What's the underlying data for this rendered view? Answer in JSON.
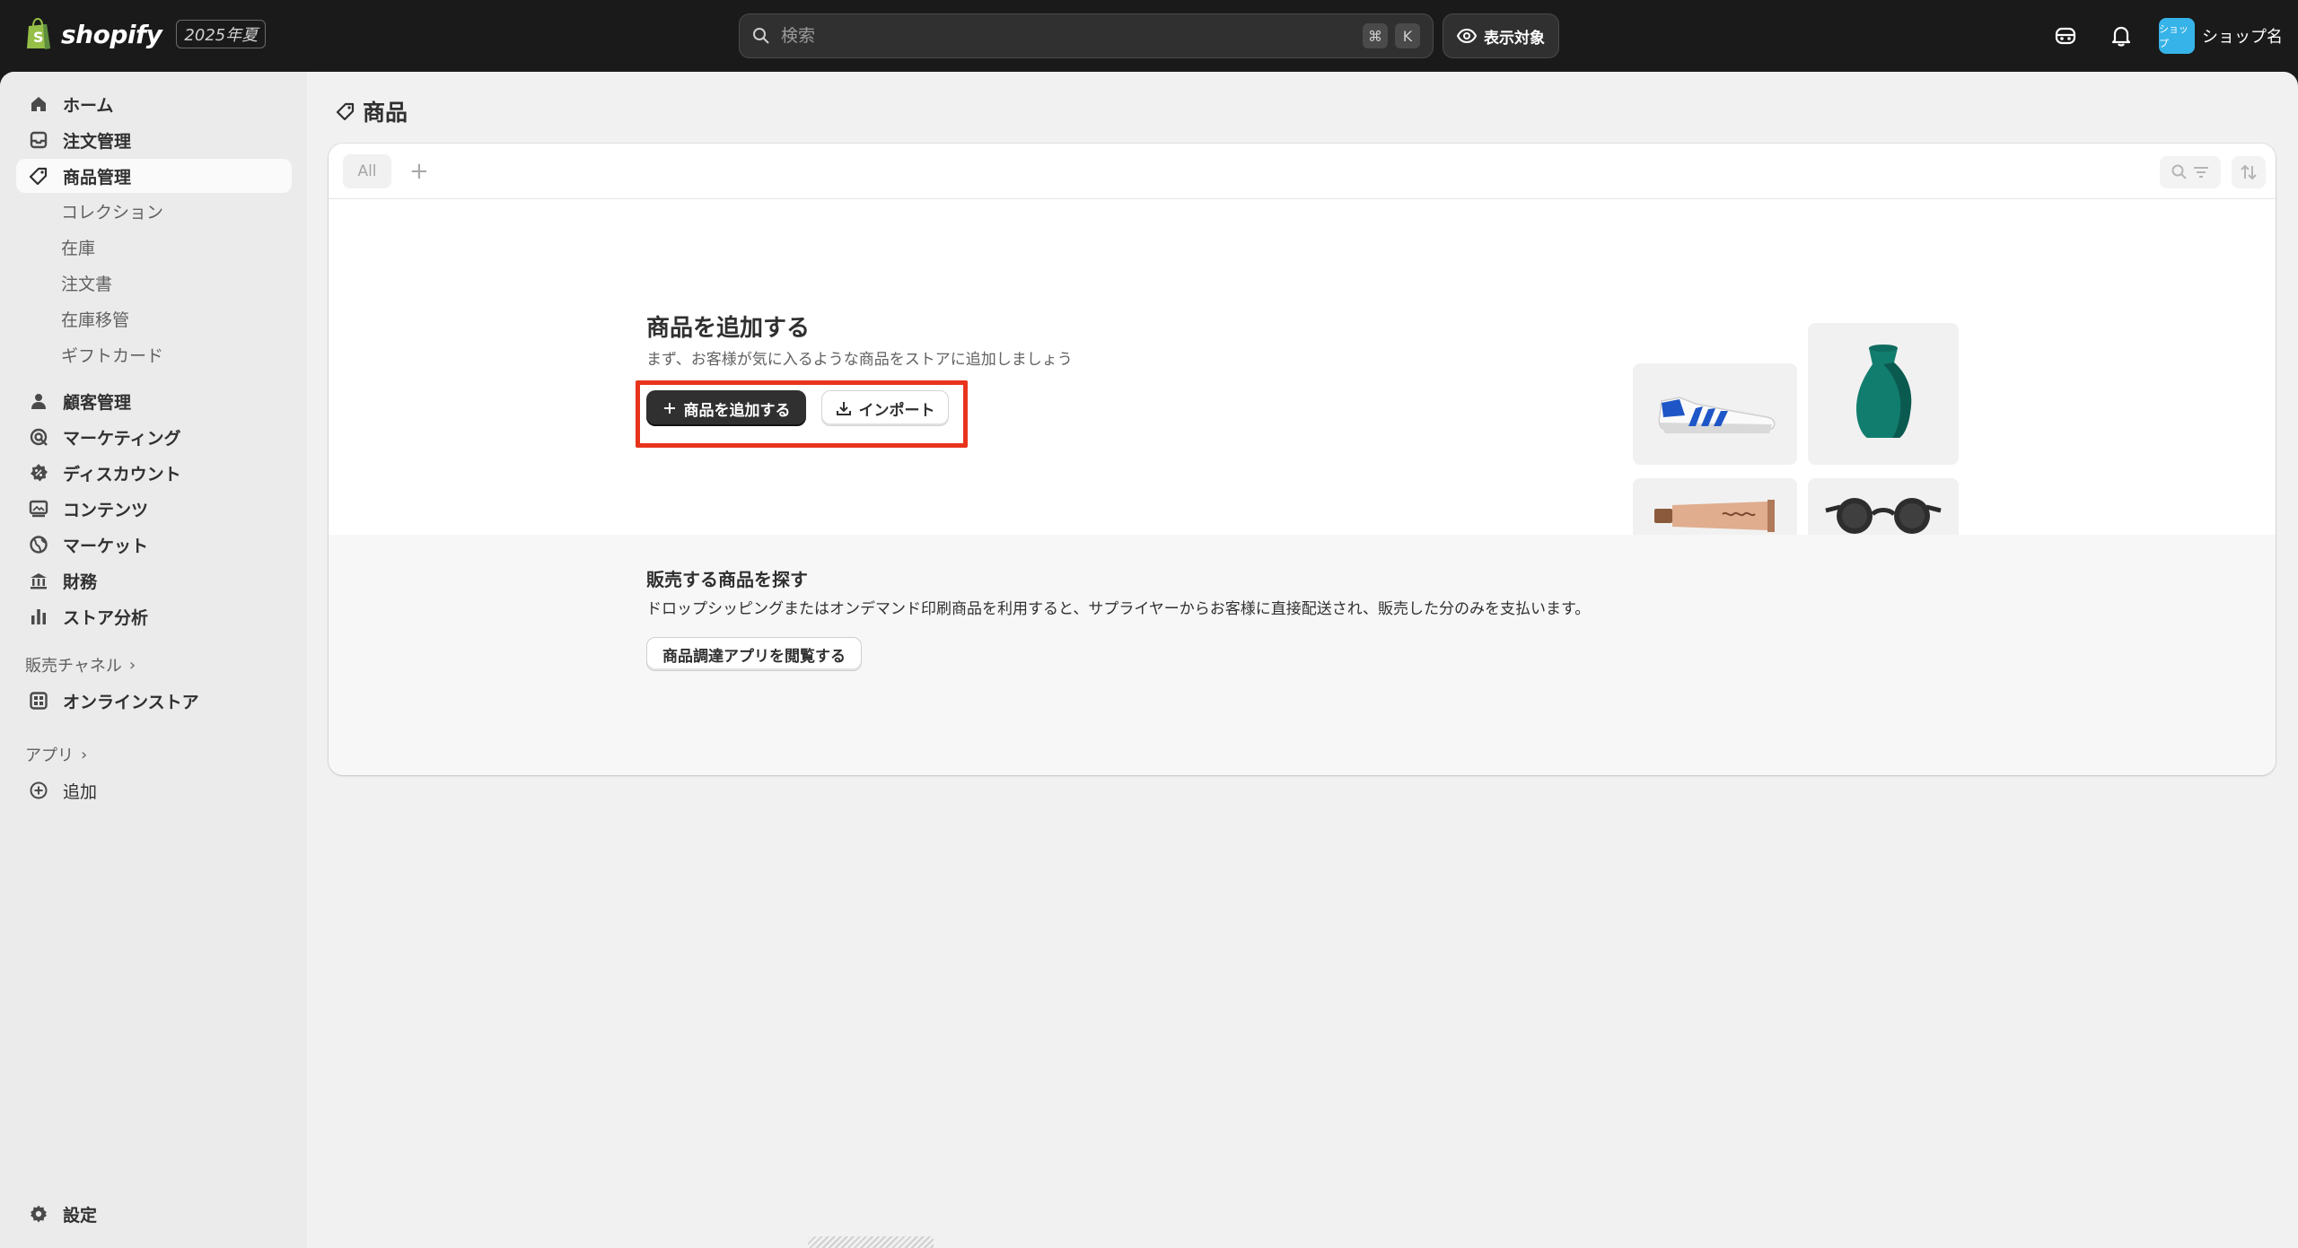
{
  "topbar": {
    "logo_text": "shopify",
    "edition": "2025年夏",
    "search_placeholder": "検索",
    "kbd_cmd": "⌘",
    "kbd_k": "K",
    "view_label": "表示対象",
    "shop_avatar": "ショップ",
    "shop_name": "ショップ名"
  },
  "sidebar": {
    "items": [
      {
        "label": "ホーム",
        "icon": "home-icon"
      },
      {
        "label": "注文管理",
        "icon": "inbox-icon"
      },
      {
        "label": "商品管理",
        "icon": "tag-icon"
      },
      {
        "label": "顧客管理",
        "icon": "person-icon"
      },
      {
        "label": "マーケティング",
        "icon": "target-icon"
      },
      {
        "label": "ディスカウント",
        "icon": "discount-icon"
      },
      {
        "label": "コンテンツ",
        "icon": "content-icon"
      },
      {
        "label": "マーケット",
        "icon": "globe-icon"
      },
      {
        "label": "財務",
        "icon": "bank-icon"
      },
      {
        "label": "ストア分析",
        "icon": "chart-icon"
      }
    ],
    "sub_items": [
      "コレクション",
      "在庫",
      "注文書",
      "在庫移管",
      "ギフトカード"
    ],
    "sales_channels_label": "販売チャネル",
    "online_store": "オンラインストア",
    "apps_label": "アプリ",
    "add_label": "追加",
    "settings_label": "設定"
  },
  "main": {
    "page_title": "商品",
    "tab_all": "All",
    "tab_add": "+",
    "empty_title": "商品を追加する",
    "empty_subtitle": "まず、お客様が気に入るような商品をストアに追加しましょう",
    "add_product_label": "商品を追加する",
    "import_label": "インポート",
    "discover_title": "販売する商品を探す",
    "discover_desc": "ドロップシッピングまたはオンデマンド印刷商品を利用すると、サプライヤーからお客様に直接配送され、販売した分のみを支払います。",
    "browse_label": "商品調達アプリを閲覧する"
  },
  "colors": {
    "highlight": "#e8341c",
    "primary_button": "#303030",
    "avatar": "#36b3e8"
  }
}
